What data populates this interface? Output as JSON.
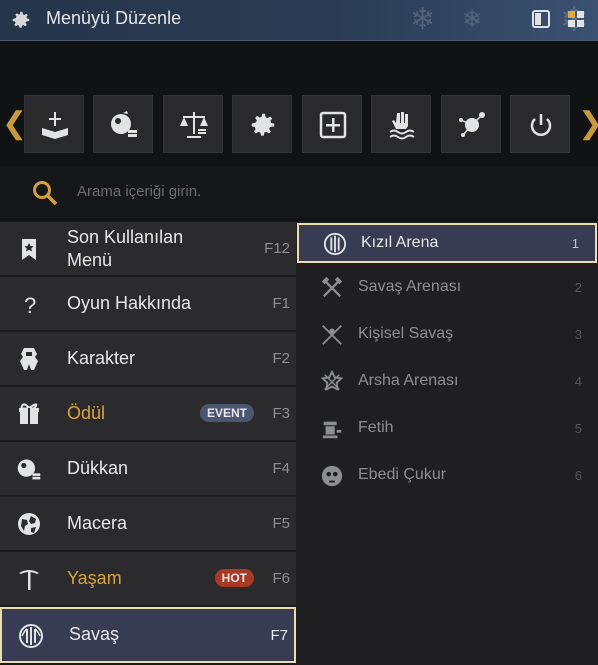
{
  "window": {
    "title": "Menüyü Düzenle",
    "icon": "gear-icon"
  },
  "quick_bar": {
    "items": [
      {
        "icon": "sword-book-icon"
      },
      {
        "icon": "shop-icon"
      },
      {
        "icon": "scales-icon"
      },
      {
        "icon": "gear-icon"
      },
      {
        "icon": "plus-box-icon"
      },
      {
        "icon": "hand-water-icon"
      },
      {
        "icon": "network-node-icon"
      },
      {
        "icon": "power-icon"
      }
    ]
  },
  "search": {
    "placeholder": "Arama içeriği girin."
  },
  "menu": {
    "items": [
      {
        "label": "Son Kullanılan Menü",
        "line1": "Son Kullanılan",
        "line2": "Menü",
        "key": "F12",
        "icon": "bookmark-icon"
      },
      {
        "label": "Oyun Hakkında",
        "key": "F1",
        "icon": "question-icon"
      },
      {
        "label": "Karakter",
        "key": "F2",
        "icon": "armor-icon"
      },
      {
        "label": "Ödül",
        "key": "F3",
        "icon": "gift-icon",
        "badge": "EVENT"
      },
      {
        "label": "Dükkan",
        "key": "F4",
        "icon": "shop-icon"
      },
      {
        "label": "Macera",
        "key": "F5",
        "icon": "globe-icon"
      },
      {
        "label": "Yaşam",
        "key": "F6",
        "icon": "pickaxe-icon",
        "badge": "HOT"
      },
      {
        "label": "Savaş",
        "key": "F7",
        "icon": "battle-emblem-icon",
        "selected": true
      }
    ]
  },
  "submenu": {
    "items": [
      {
        "label": "Kızıl Arena",
        "num": "1",
        "icon": "battle-emblem-icon",
        "selected": true
      },
      {
        "label": "Savaş Arenası",
        "num": "2",
        "icon": "crossed-axes-icon"
      },
      {
        "label": "Kişisel Savaş",
        "num": "3",
        "icon": "crossed-swords-icon"
      },
      {
        "label": "Arsha Arenası",
        "num": "4",
        "icon": "arsha-emblem-icon"
      },
      {
        "label": "Fetih",
        "num": "5",
        "icon": "conquest-icon"
      },
      {
        "label": "Ebedi Çukur",
        "num": "6",
        "icon": "skull-emblem-icon"
      }
    ]
  },
  "colors": {
    "accent_gold": "#d9a33c",
    "selected_border": "#efdcae",
    "selected_bg": "#383c52",
    "hot_badge": "#a83a24",
    "event_badge": "#4b5670"
  }
}
